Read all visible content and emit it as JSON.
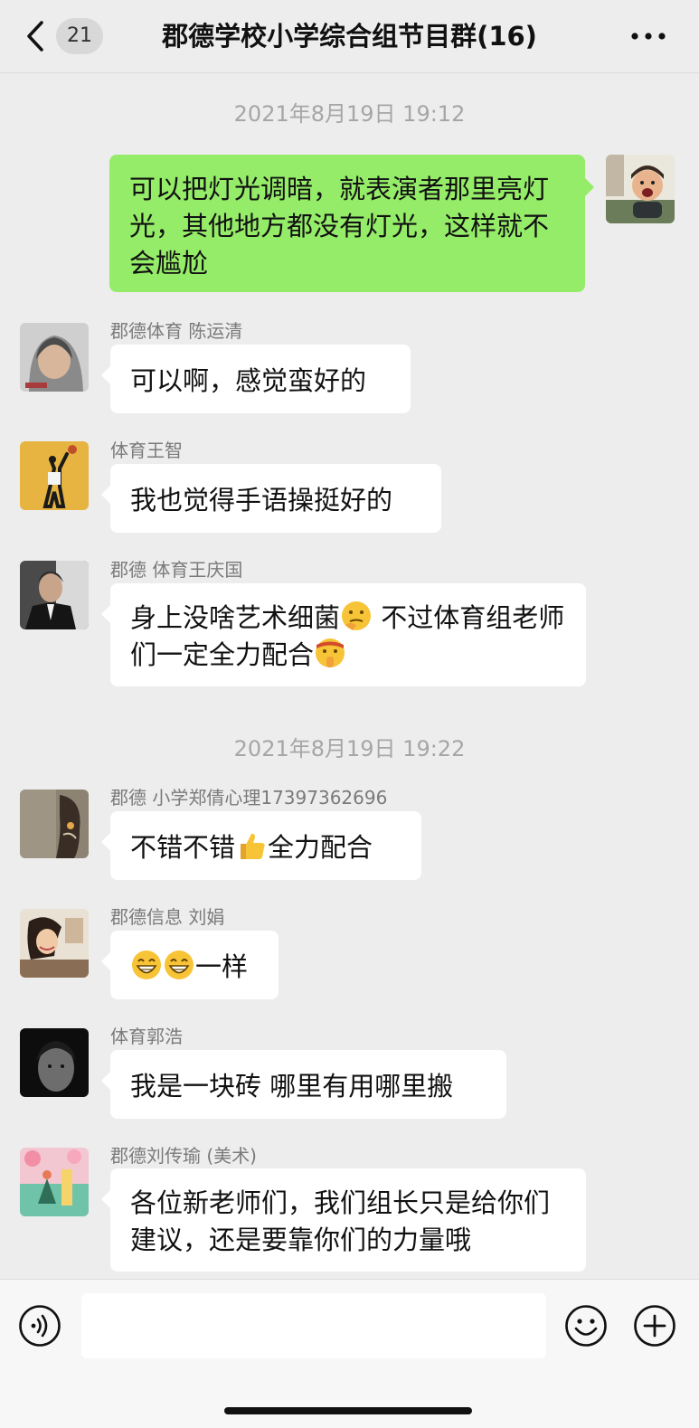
{
  "header": {
    "back_icon": "chevron-left-icon",
    "unread_count": "21",
    "title": "郡德学校小学综合组节目群(16)",
    "more_icon": "more-icon"
  },
  "timestamps": [
    "2021年8月19日 19:12",
    "2021年8月19日 19:22"
  ],
  "messages": [
    {
      "self": true,
      "text": "可以把灯光调暗，就表演者那里亮灯光，其他地方都没有灯光，这样就不会尴尬"
    },
    {
      "sender": "郡德体育  陈运清",
      "text": "可以啊，感觉蛮好的"
    },
    {
      "sender": "体育王智",
      "text": "我也觉得手语操挺好的"
    },
    {
      "sender": "郡德 体育王庆国",
      "text_a": "身上没啥艺术细菌",
      "text_b": "  不过体育组老师们一定全力配合",
      "emojis": [
        "thinking-face-emoji",
        "shushing-face-emoji"
      ]
    },
    {
      "sender": "郡德 小学郑倩心理17397362696",
      "text_a": "不错不错",
      "text_b": "全力配合",
      "emojis": [
        "thumbs-up-emoji"
      ]
    },
    {
      "sender": "郡德信息 刘娟",
      "text": "一样",
      "emojis": [
        "grinning-face-emoji",
        "grinning-face-emoji"
      ]
    },
    {
      "sender": "体育郭浩",
      "text": "我是一块砖 哪里有用哪里搬"
    },
    {
      "sender": "郡德刘传瑜 (美术)",
      "text": "各位新老师们，我们组长只是给你们建议，还是要靠你们的力量哦"
    }
  ],
  "input_bar": {
    "voice_icon": "voice-icon",
    "input_value": "",
    "emoji_icon": "emoji-icon",
    "plus_icon": "plus-icon"
  },
  "colors": {
    "background": "#ededed",
    "self_bubble": "#95ec69",
    "other_bubble": "#ffffff",
    "timestamp": "#a6a6a6"
  }
}
